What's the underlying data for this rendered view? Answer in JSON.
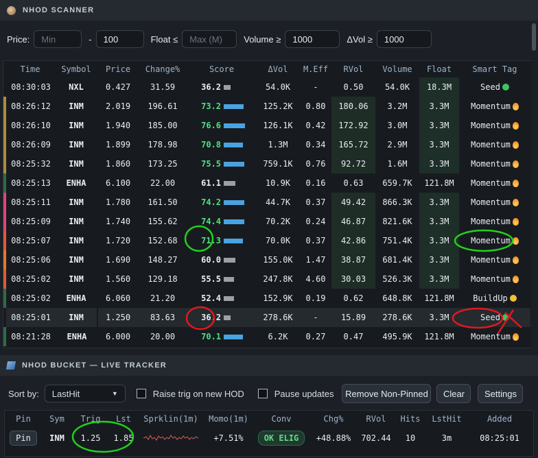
{
  "scanner": {
    "title": "NHOD SCANNER",
    "filters": {
      "price_label": "Price:",
      "price_min_placeholder": "Min",
      "dash": "-",
      "price_max_value": "100",
      "float_label": "Float ≤",
      "float_placeholder": "Max (M)",
      "volume_label": "Volume ≥",
      "volume_value": "1000",
      "dvol_label": "ΔVol ≥",
      "dvol_value": "1000"
    },
    "columns": [
      "Time",
      "Symbol",
      "Price",
      "Change%",
      "Score",
      "ΔVol",
      "M.Eff",
      "RVol",
      "Volume",
      "Float",
      "Smart Tag"
    ],
    "rows": [
      {
        "time": "08:30:03",
        "sym": "NXL",
        "price": "0.427",
        "chg": "31.59",
        "score": "36.2",
        "score_level": 0.36,
        "score_color": "white",
        "dvol": "54.0K",
        "meff": "-",
        "rvol": "0.50",
        "vol": "54.0K",
        "float": "18.3M",
        "tag": "Seed",
        "tag_icon": "green-dot",
        "edge": "",
        "rvol_hi": false
      },
      {
        "time": "08:26:12",
        "sym": "INM",
        "price": "2.019",
        "chg": "196.61",
        "score": "73.2",
        "score_level": 0.73,
        "score_color": "green",
        "dvol": "125.2K",
        "meff": "0.80",
        "rvol": "180.06",
        "vol": "3.2M",
        "float": "3.3M",
        "tag": "Momentum",
        "tag_icon": "fire",
        "edge": "#b08a3a",
        "rvol_hi": true
      },
      {
        "time": "08:26:10",
        "sym": "INM",
        "price": "1.940",
        "chg": "185.00",
        "score": "76.6",
        "score_level": 0.77,
        "score_color": "green",
        "dvol": "126.1K",
        "meff": "0.42",
        "rvol": "172.92",
        "vol": "3.0M",
        "float": "3.3M",
        "tag": "Momentum",
        "tag_icon": "fire",
        "edge": "#b08a3a",
        "rvol_hi": true
      },
      {
        "time": "08:26:09",
        "sym": "INM",
        "price": "1.899",
        "chg": "178.98",
        "score": "70.8",
        "score_level": 0.71,
        "score_color": "green",
        "dvol": "1.3M",
        "meff": "0.34",
        "rvol": "165.72",
        "vol": "2.9M",
        "float": "3.3M",
        "tag": "Momentum",
        "tag_icon": "fire",
        "edge": "#b08a3a",
        "rvol_hi": true
      },
      {
        "time": "08:25:32",
        "sym": "INM",
        "price": "1.860",
        "chg": "173.25",
        "score": "75.5",
        "score_level": 0.76,
        "score_color": "green",
        "dvol": "759.1K",
        "meff": "0.76",
        "rvol": "92.72",
        "vol": "1.6M",
        "float": "3.3M",
        "tag": "Momentum",
        "tag_icon": "fire",
        "edge": "#b08a3a",
        "rvol_hi": true
      },
      {
        "time": "08:25:13",
        "sym": "ENHA",
        "price": "6.100",
        "chg": "22.00",
        "score": "61.1",
        "score_level": 0.61,
        "score_color": "white",
        "dvol": "10.9K",
        "meff": "0.16",
        "rvol": "0.63",
        "vol": "659.7K",
        "float": "121.8M",
        "tag": "Momentum",
        "tag_icon": "fire",
        "edge": "#2e6b48",
        "rvol_hi": false
      },
      {
        "time": "08:25:11",
        "sym": "INM",
        "price": "1.780",
        "chg": "161.50",
        "score": "74.2",
        "score_level": 0.74,
        "score_color": "green",
        "dvol": "44.7K",
        "meff": "0.37",
        "rvol": "49.42",
        "vol": "866.3K",
        "float": "3.3M",
        "tag": "Momentum",
        "tag_icon": "fire",
        "edge": "#e0457a",
        "rvol_hi": true
      },
      {
        "time": "08:25:09",
        "sym": "INM",
        "price": "1.740",
        "chg": "155.62",
        "score": "74.4",
        "score_level": 0.74,
        "score_color": "green",
        "dvol": "70.2K",
        "meff": "0.24",
        "rvol": "46.87",
        "vol": "821.6K",
        "float": "3.3M",
        "tag": "Momentum",
        "tag_icon": "fire",
        "edge": "#e0457a",
        "rvol_hi": true
      },
      {
        "time": "08:25:07",
        "sym": "INM",
        "price": "1.720",
        "chg": "152.68",
        "score": "71.3",
        "score_level": 0.71,
        "score_color": "green",
        "dvol": "70.0K",
        "meff": "0.37",
        "rvol": "42.86",
        "vol": "751.4K",
        "float": "3.3M",
        "tag": "Momentum",
        "tag_icon": "fire",
        "edge": "#e05a3a",
        "rvol_hi": true
      },
      {
        "time": "08:25:06",
        "sym": "INM",
        "price": "1.690",
        "chg": "148.27",
        "score": "60.0",
        "score_level": 0.6,
        "score_color": "white",
        "dvol": "155.0K",
        "meff": "1.47",
        "rvol": "38.87",
        "vol": "681.4K",
        "float": "3.3M",
        "tag": "Momentum",
        "tag_icon": "fire",
        "edge": "#e07a2a",
        "rvol_hi": true
      },
      {
        "time": "08:25:02",
        "sym": "INM",
        "price": "1.560",
        "chg": "129.18",
        "score": "55.5",
        "score_level": 0.55,
        "score_color": "white",
        "dvol": "247.8K",
        "meff": "4.60",
        "rvol": "30.03",
        "vol": "526.3K",
        "float": "3.3M",
        "tag": "Momentum",
        "tag_icon": "fire",
        "edge": "#e05a3a",
        "rvol_hi": true
      },
      {
        "time": "08:25:02",
        "sym": "ENHA",
        "price": "6.060",
        "chg": "21.20",
        "score": "52.4",
        "score_level": 0.52,
        "score_color": "white",
        "dvol": "152.9K",
        "meff": "0.19",
        "rvol": "0.62",
        "vol": "648.8K",
        "float": "121.8M",
        "tag": "BuildUp",
        "tag_icon": "yellow-dot",
        "edge": "#2e6b48",
        "rvol_hi": false
      },
      {
        "time": "08:25:01",
        "sym": "INM",
        "price": "1.250",
        "chg": "83.63",
        "score": "36.2",
        "score_level": 0.36,
        "score_color": "white",
        "dvol": "278.6K",
        "meff": "-",
        "rvol": "15.89",
        "vol": "278.6K",
        "float": "3.3M",
        "tag": "Seed",
        "tag_icon": "green-dot",
        "edge": "",
        "rvol_hi": true,
        "selected": true
      },
      {
        "time": "08:21:28",
        "sym": "ENHA",
        "price": "6.000",
        "chg": "20.00",
        "score": "70.1",
        "score_level": 0.7,
        "score_color": "green",
        "dvol": "6.2K",
        "meff": "0.27",
        "rvol": "0.47",
        "vol": "495.9K",
        "float": "121.8M",
        "tag": "Momentum",
        "tag_icon": "fire",
        "edge": "#2e6b48",
        "rvol_hi": false
      }
    ]
  },
  "bucket": {
    "title": "NHOD BUCKET — LIVE TRACKER",
    "sort_label": "Sort by:",
    "sort_value": "LastHit",
    "raise_trig_label": "Raise trig on new HOD",
    "pause_label": "Pause updates",
    "remove_btn": "Remove Non-Pinned",
    "clear_btn": "Clear",
    "settings_btn": "Settings",
    "columns": [
      "Pin",
      "Sym",
      "Trig",
      "Lst",
      "Sprklin(1m)",
      "Momo(1m)",
      "Conv",
      "Chg%",
      "RVol",
      "Hits",
      "LstHit",
      "Added"
    ],
    "row": {
      "pin": "Pin",
      "sym": "INM",
      "trig": "1.25",
      "lst": "1.85",
      "momo": "+7.51%",
      "conv": "OK ELIG",
      "chg": "+48.88%",
      "rvol": "702.44",
      "hits": "10",
      "lsthit": "3m",
      "added": "08:25:01"
    }
  },
  "colors": {
    "accent": "#4aa3e0",
    "green": "#4fe07f",
    "symbol": "#5aa9ff",
    "annotation_green": "#22d11a",
    "annotation_red": "#e0191e"
  }
}
